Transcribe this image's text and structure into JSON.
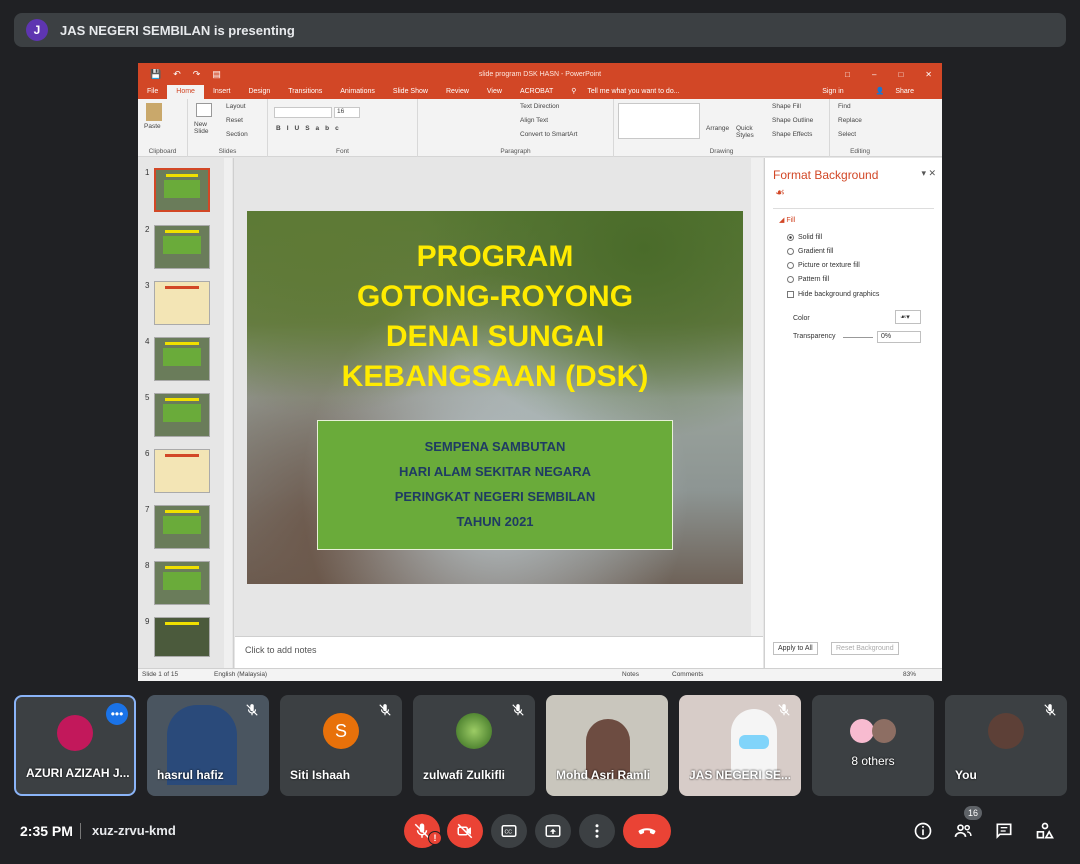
{
  "banner": {
    "avatar_letter": "J",
    "text": "JAS NEGERI SEMBILAN is presenting"
  },
  "ppt": {
    "window_title": "slide program DSK HASN - PowerPoint",
    "tabs": [
      "File",
      "Home",
      "Insert",
      "Design",
      "Transitions",
      "Animations",
      "Slide Show",
      "Review",
      "View",
      "ACROBAT"
    ],
    "tell_me": "Tell me what you want to do...",
    "sign_in": "Sign in",
    "share": "Share",
    "ribbon": {
      "paste": "Paste",
      "new_slide": "New Slide",
      "layout": "Layout",
      "reset": "Reset",
      "section": "Section",
      "font_size": "16",
      "text_direction": "Text Direction",
      "align_text": "Align Text",
      "smartart": "Convert to SmartArt",
      "arrange": "Arrange",
      "quick_styles": "Quick Styles",
      "shape_fill": "Shape Fill",
      "shape_outline": "Shape Outline",
      "shape_effects": "Shape Effects",
      "find": "Find",
      "replace": "Replace",
      "select": "Select",
      "groups": [
        "Clipboard",
        "Slides",
        "Font",
        "Paragraph",
        "Drawing",
        "Editing"
      ]
    },
    "thumb_numbers": [
      "1",
      "2",
      "3",
      "4",
      "5",
      "6",
      "7",
      "8",
      "9"
    ],
    "slide": {
      "title_lines": [
        "PROGRAM",
        "GOTONG-ROYONG",
        "DENAI SUNGAI",
        "KEBANGSAAN (DSK)"
      ],
      "box_lines": [
        "SEMPENA SAMBUTAN",
        "HARI ALAM SEKITAR NEGARA",
        "PERINGKAT NEGERI SEMBILAN",
        "TAHUN 2021"
      ]
    },
    "notes_placeholder": "Click to add notes",
    "format_pane": {
      "title": "Format Background",
      "section": "Fill",
      "options": [
        "Solid fill",
        "Gradient fill",
        "Picture or texture fill",
        "Pattern fill"
      ],
      "hide_graphics": "Hide background graphics",
      "color_label": "Color",
      "transparency_label": "Transparency",
      "transparency_value": "0%",
      "apply_all": "Apply to All",
      "reset_bg": "Reset Background"
    },
    "status": {
      "slide_of": "Slide 1 of 15",
      "language": "English (Malaysia)",
      "notes": "Notes",
      "comments": "Comments",
      "zoom": "83%"
    }
  },
  "participants": [
    {
      "name": "AZURI AZIZAH J...",
      "muted": false,
      "pinned": true
    },
    {
      "name": "hasrul hafiz",
      "muted": true
    },
    {
      "name": "Siti Ishaah",
      "letter": "S",
      "muted": true
    },
    {
      "name": "zulwafi Zulkifli",
      "muted": true
    },
    {
      "name": "Mohd Asri Ramli",
      "muted": false
    },
    {
      "name": "JAS NEGERI SE...",
      "muted": true
    },
    {
      "name": "8 others",
      "muted": false
    },
    {
      "name": "You",
      "muted": true
    }
  ],
  "bottom_bar": {
    "time": "2:35 PM",
    "meeting_code": "xuz-zrvu-kmd",
    "people_count": "16",
    "mic_alert": "!"
  },
  "colors": {
    "ppt_accent": "#d24726",
    "slide_title": "#ffeb00",
    "slide_box": "#6aab3a",
    "meet_red": "#ea4335",
    "pin_border": "#8ab4f8"
  }
}
